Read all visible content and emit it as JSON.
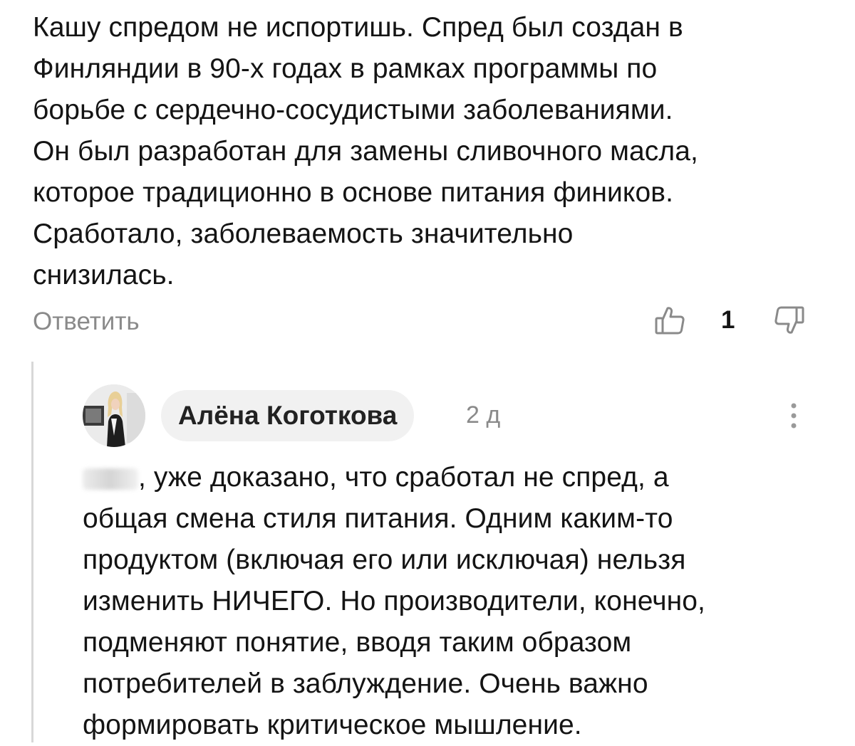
{
  "comment": {
    "text": "Кашу спредом не испортишь. Спред был создан в Финляндии в 90-х годах в рамках программы по борьбе с сердечно-сосудистыми заболеваниями. Он был разработан для замены сливочного масла, которое традиционно в основе питания фиников. Сработало, заболеваемость значительно снизилась.",
    "lines": [
      "Кашу спредом не испортишь. Спред был создан в",
      "Финляндии в 90-х годах в рамках программы по",
      "борьбе с сердечно-сосудистыми заболеваниями.",
      "Он был разработан для замены сливочного масла,",
      "которое традиционно в основе питания фиников.",
      "Сработало, заболеваемость значительно",
      "снизилась."
    ],
    "reply_label": "Ответить",
    "like_count": "1",
    "like_icon": "thumbs-up-icon",
    "dislike_icon": "thumbs-down-icon"
  },
  "reply": {
    "author": "Алёна Коготкова",
    "timestamp": "2 д",
    "more_icon": "more-vertical-icon",
    "text_after_mention": ", уже доказано, что сработал не спред, а общая смена стиля питания. Одним каким-то продуктом (включая его или исключая) нельзя изменить НИЧЕГО. Но производители, конечно, подменяют понятие, вводя таким образом потребителей в заблуждение. Очень важно формировать критическое мышление.",
    "lines": [
      ", уже доказано, что сработал не спред, а",
      "общая смена стиля питания. Одним каким-то",
      "продуктом (включая его или исключая) нельзя",
      "изменить НИЧЕГО. Но производители, конечно,",
      "подменяют понятие, вводя таким образом",
      "потребителей в заблуждение. Очень важно",
      "формировать критическое мышление."
    ]
  },
  "colors": {
    "text": "#141414",
    "muted": "#8a8a8a",
    "pill_bg": "#f1f1f1",
    "thread_line": "#d8d8d8"
  }
}
